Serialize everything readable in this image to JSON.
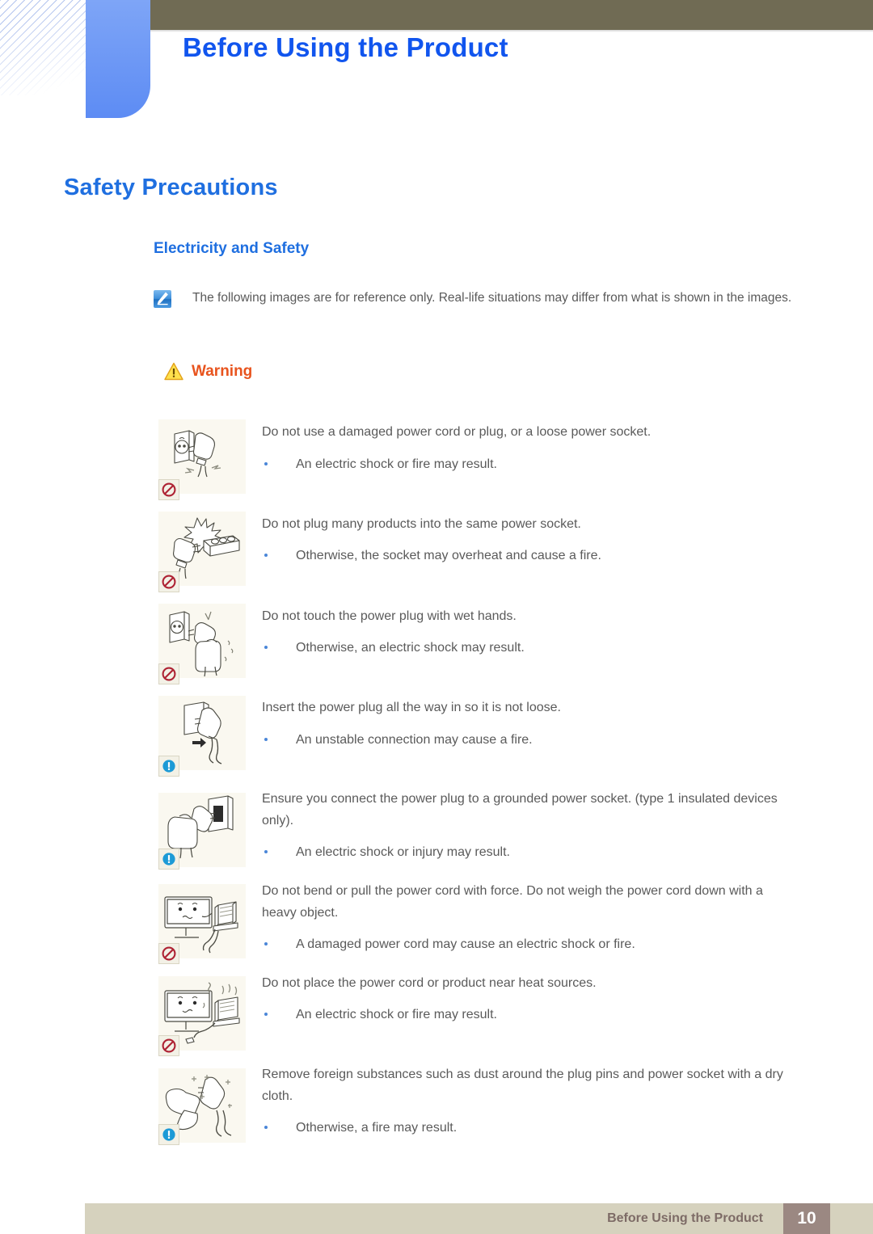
{
  "header": {
    "chapter_title": "Before Using the Product",
    "bar_color": "#706B54",
    "tab_color": "#6C97F5",
    "title_color": "#1155EE"
  },
  "headings": {
    "h1": "Safety Precautions",
    "h2": "Electricity and Safety",
    "color": "#1F6FE0"
  },
  "note": {
    "icon": "note-pen-icon",
    "text": "The following images are for reference only. Real-life situations may differ from what is shown in the images."
  },
  "warning": {
    "icon": "warning-triangle-icon",
    "label": "Warning",
    "color": "#E8541E"
  },
  "items": [
    {
      "figure": "damaged-power-cord-figure",
      "badge": "prohibition-icon",
      "statement": "Do not use a damaged power cord or plug, or a loose power socket.",
      "bullets": [
        "An electric shock or fire may result."
      ]
    },
    {
      "figure": "overloaded-power-strip-figure",
      "badge": "prohibition-icon",
      "statement": "Do not plug many products into the same power socket.",
      "bullets": [
        "Otherwise, the socket may overheat and cause a fire."
      ]
    },
    {
      "figure": "wet-hands-plug-figure",
      "badge": "prohibition-icon",
      "statement": "Do not touch the power plug with wet hands.",
      "bullets": [
        "Otherwise, an electric shock may result."
      ]
    },
    {
      "figure": "insert-plug-fully-figure",
      "badge": "caution-info-icon",
      "statement": "Insert the power plug all the way in so it is not loose.",
      "bullets": [
        "An unstable connection may cause a fire."
      ]
    },
    {
      "figure": "grounded-socket-figure",
      "badge": "caution-info-icon",
      "statement": "Ensure you connect the power plug to a grounded power socket. (type 1 insulated devices only).",
      "bullets": [
        "An electric shock or injury may result."
      ]
    },
    {
      "figure": "bent-cord-heavy-object-figure",
      "badge": "prohibition-icon",
      "statement": "Do not bend or pull the power cord with force. Do not weigh the power cord down with a heavy object.",
      "bullets": [
        "A damaged power cord may cause an electric shock or fire."
      ]
    },
    {
      "figure": "cord-near-heat-source-figure",
      "badge": "prohibition-icon",
      "statement": "Do not place the power cord or product near heat sources.",
      "bullets": [
        "An electric shock or fire may result."
      ]
    },
    {
      "figure": "clean-plug-pins-figure",
      "badge": "caution-info-icon",
      "statement": "Remove foreign substances such as dust around the plug pins and power socket with a dry cloth.",
      "bullets": [
        "Otherwise, a fire may result."
      ]
    }
  ],
  "footer": {
    "label": "Before Using the Product",
    "page_number": "10",
    "bar_color": "#D6D2BE",
    "page_box_color": "#9B8882"
  }
}
